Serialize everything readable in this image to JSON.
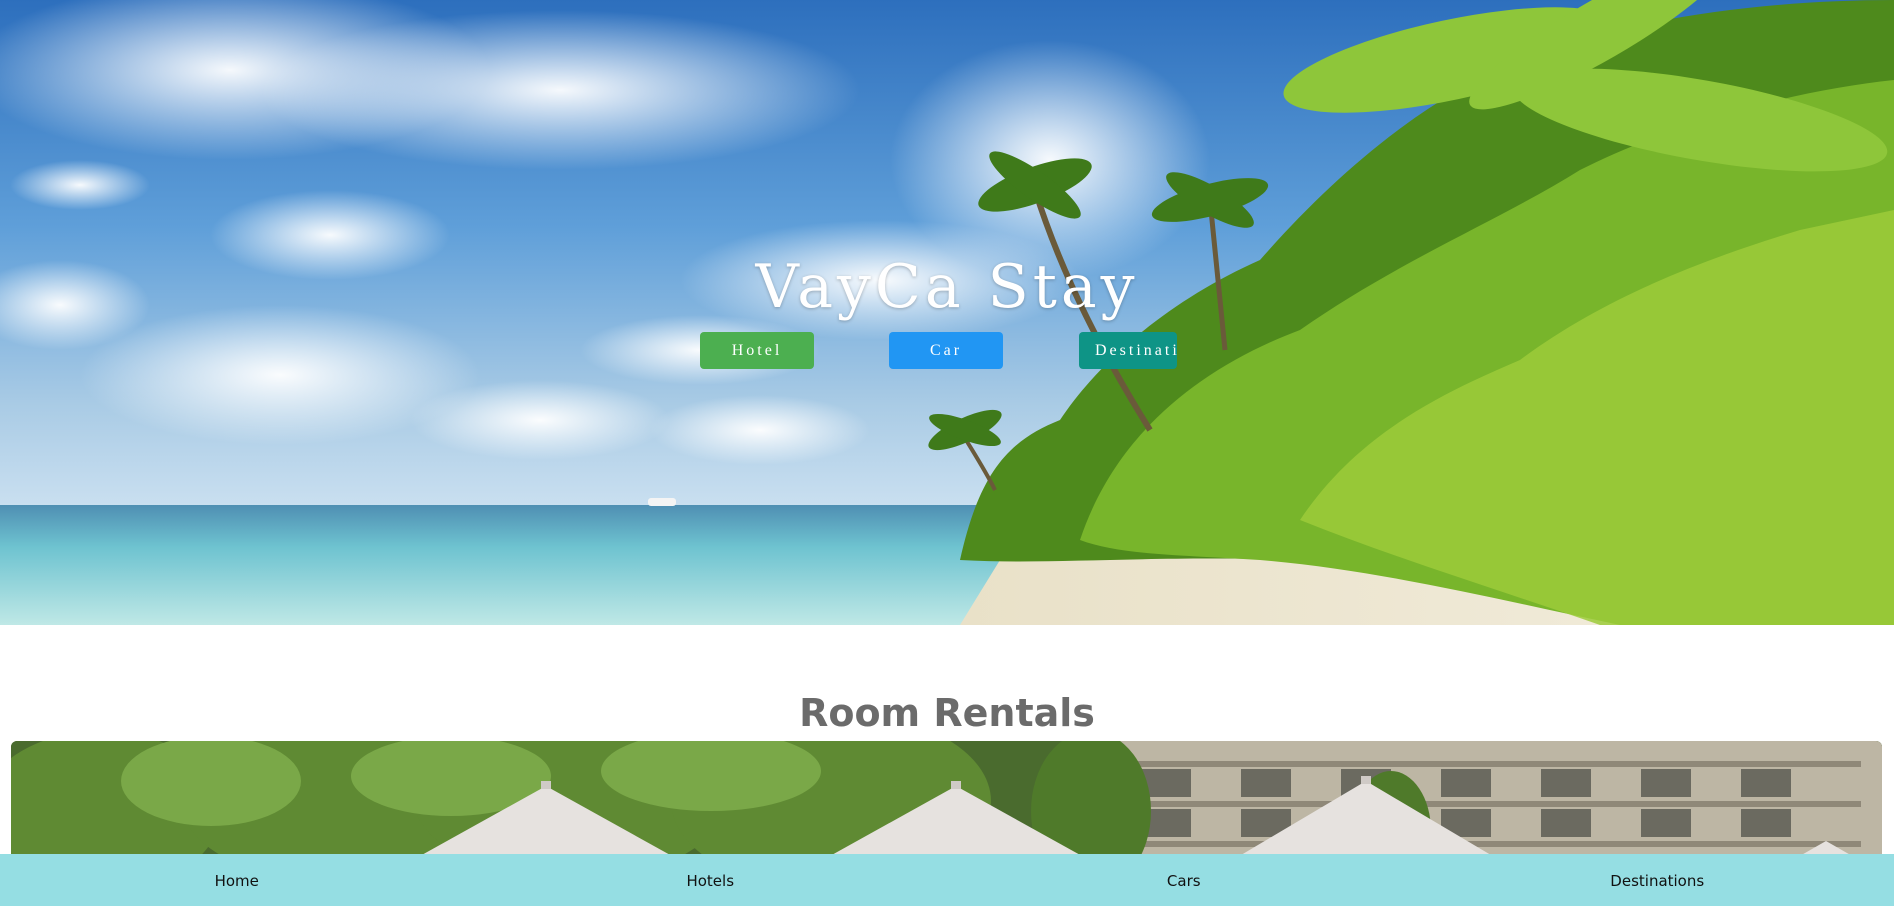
{
  "hero": {
    "title": "VayCa Stay",
    "buttons": {
      "hotel": "Hotel",
      "car": "Car",
      "destinations": "Destinations"
    },
    "colors": {
      "hotel": "#4caf50",
      "car": "#2196f3",
      "destinations": "#0e9486"
    }
  },
  "section": {
    "title": "Room Rentals"
  },
  "bottom_nav": {
    "items": [
      {
        "label": "Home"
      },
      {
        "label": "Hotels"
      },
      {
        "label": "Cars"
      },
      {
        "label": "Destinations"
      }
    ],
    "background": "#95dee3"
  }
}
